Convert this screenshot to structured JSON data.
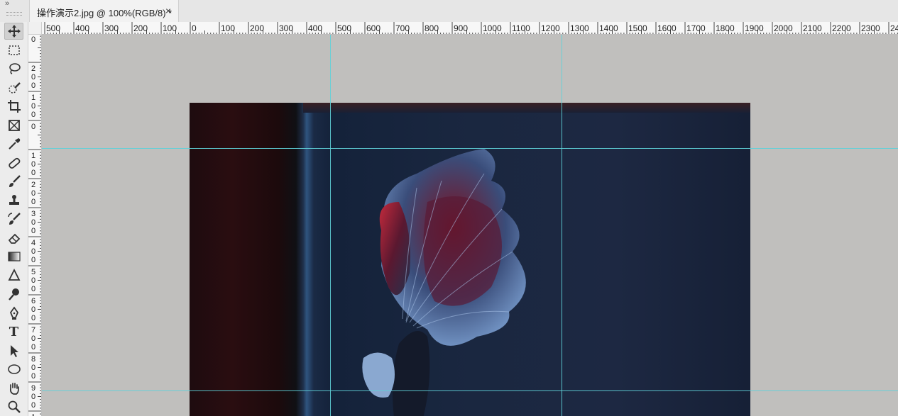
{
  "document": {
    "tab_title": "操作演示2.jpg @ 100%(RGB/8) *",
    "close_glyph": "×",
    "collapse_glyph": "»"
  },
  "toolbar": {
    "tools": [
      {
        "name": "move-tool",
        "icon": "move-icon",
        "active": true
      },
      {
        "name": "marquee-tool",
        "icon": "rect-marquee-icon"
      },
      {
        "name": "lasso-tool",
        "icon": "lasso-icon"
      },
      {
        "name": "quick-selection-tool",
        "icon": "quick-select-icon"
      },
      {
        "name": "crop-tool",
        "icon": "crop-icon"
      },
      {
        "name": "frame-tool",
        "icon": "frame-icon"
      },
      {
        "name": "eyedropper-tool",
        "icon": "eyedropper-icon"
      },
      {
        "name": "healing-brush-tool",
        "icon": "bandage-icon"
      },
      {
        "name": "brush-tool",
        "icon": "brush-icon"
      },
      {
        "name": "clone-stamp-tool",
        "icon": "stamp-icon"
      },
      {
        "name": "history-brush-tool",
        "icon": "history-brush-icon"
      },
      {
        "name": "eraser-tool",
        "icon": "eraser-icon"
      },
      {
        "name": "gradient-tool",
        "icon": "gradient-icon"
      },
      {
        "name": "blur-tool",
        "icon": "blur-icon"
      },
      {
        "name": "dodge-tool",
        "icon": "dodge-icon"
      },
      {
        "name": "pen-tool",
        "icon": "pen-icon"
      },
      {
        "name": "type-tool",
        "icon": "type-icon",
        "glyph": "T"
      },
      {
        "name": "path-selection-tool",
        "icon": "arrow-icon"
      },
      {
        "name": "ellipse-tool",
        "icon": "ellipse-icon"
      },
      {
        "name": "hand-tool",
        "icon": "hand-icon"
      },
      {
        "name": "zoom-tool",
        "icon": "zoom-icon"
      }
    ]
  },
  "rulers": {
    "horizontal_labels": [
      "500",
      "400",
      "300",
      "200",
      "100",
      "0",
      "100",
      "200",
      "300",
      "400",
      "500",
      "600",
      "700",
      "800",
      "900",
      "1000",
      "1100",
      "1200",
      "1300",
      "1400",
      "1500",
      "1600",
      "1700",
      "1800",
      "1900",
      "2000",
      "2100",
      "2200",
      "2300",
      "24"
    ],
    "vertical_labels": [
      [
        "0"
      ],
      [
        "2",
        "0",
        "0"
      ],
      [
        "1",
        "0",
        "0"
      ],
      [
        "0"
      ],
      [
        "1",
        "0",
        "0"
      ],
      [
        "2",
        "0",
        "0"
      ],
      [
        "3",
        "0",
        "0"
      ],
      [
        "4",
        "0",
        "0"
      ],
      [
        "5",
        "0",
        "0"
      ],
      [
        "6",
        "0",
        "0"
      ],
      [
        "7",
        "0",
        "0"
      ],
      [
        "8",
        "0",
        "0"
      ],
      [
        "9",
        "0",
        "0"
      ],
      [
        "1"
      ]
    ]
  },
  "colors": {
    "guide": "#5fd0d8",
    "pasteboard": "#c0bfbd",
    "toolbar_bg": "#ececec"
  }
}
